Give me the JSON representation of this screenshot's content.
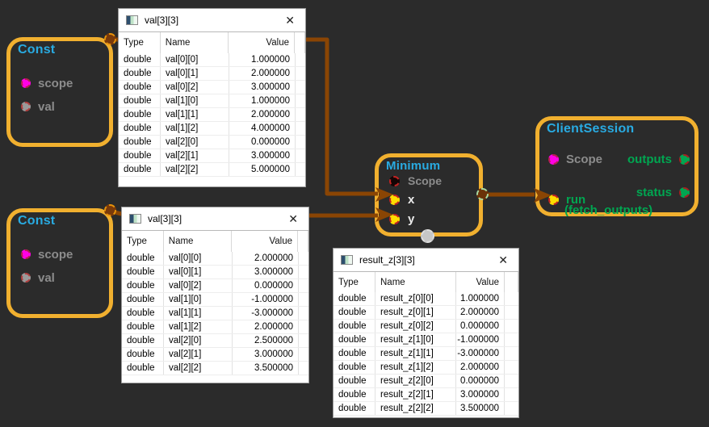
{
  "colors": {
    "background": "#2b2b2b",
    "node_border": "#f1b02f",
    "node_title": "#29abe2",
    "port_label_gray": "#8c8c8c",
    "port_label_white": "#eaeaea",
    "green": "#00a651",
    "magenta": "#ff00e6",
    "port_yellow": "#ffdd00",
    "wire": "#8a4504"
  },
  "nodes": {
    "const1": {
      "title": "Const",
      "ports": [
        {
          "label": "scope"
        },
        {
          "label": "val"
        }
      ]
    },
    "const2": {
      "title": "Const",
      "ports": [
        {
          "label": "scope"
        },
        {
          "label": "val"
        }
      ]
    },
    "minimum": {
      "title": "Minimum",
      "ports": [
        {
          "label": "Scope"
        },
        {
          "label": "x"
        },
        {
          "label": "y"
        }
      ]
    },
    "client_session": {
      "title": "ClientSession",
      "scope_label": "Scope",
      "outputs_label": "outputs",
      "status_label": "status",
      "run_label": "run",
      "run_sublabel": "(fetch_outputs)"
    }
  },
  "window_chrome": {
    "close_glyph": "✕"
  },
  "tables": [
    {
      "title": "val[3][3]",
      "columns": [
        "Type",
        "Name",
        "Value"
      ],
      "rows": [
        [
          "double",
          "val[0][0]",
          "1.000000"
        ],
        [
          "double",
          "val[0][1]",
          "2.000000"
        ],
        [
          "double",
          "val[0][2]",
          "3.000000"
        ],
        [
          "double",
          "val[1][0]",
          "1.000000"
        ],
        [
          "double",
          "val[1][1]",
          "2.000000"
        ],
        [
          "double",
          "val[1][2]",
          "4.000000"
        ],
        [
          "double",
          "val[2][0]",
          "0.000000"
        ],
        [
          "double",
          "val[2][1]",
          "3.000000"
        ],
        [
          "double",
          "val[2][2]",
          "5.000000"
        ]
      ]
    },
    {
      "title": "val[3][3]",
      "columns": [
        "Type",
        "Name",
        "Value"
      ],
      "rows": [
        [
          "double",
          "val[0][0]",
          "2.000000"
        ],
        [
          "double",
          "val[0][1]",
          "3.000000"
        ],
        [
          "double",
          "val[0][2]",
          "0.000000"
        ],
        [
          "double",
          "val[1][0]",
          "-1.000000"
        ],
        [
          "double",
          "val[1][1]",
          "-3.000000"
        ],
        [
          "double",
          "val[1][2]",
          "2.000000"
        ],
        [
          "double",
          "val[2][0]",
          "2.500000"
        ],
        [
          "double",
          "val[2][1]",
          "3.000000"
        ],
        [
          "double",
          "val[2][2]",
          "3.500000"
        ]
      ]
    },
    {
      "title": "result_z[3][3]",
      "columns": [
        "Type",
        "Name",
        "Value"
      ],
      "rows": [
        [
          "double",
          "result_z[0][0]",
          "1.000000"
        ],
        [
          "double",
          "result_z[0][1]",
          "2.000000"
        ],
        [
          "double",
          "result_z[0][2]",
          "0.000000"
        ],
        [
          "double",
          "result_z[1][0]",
          "-1.000000"
        ],
        [
          "double",
          "result_z[1][1]",
          "-3.000000"
        ],
        [
          "double",
          "result_z[1][2]",
          "2.000000"
        ],
        [
          "double",
          "result_z[2][0]",
          "0.000000"
        ],
        [
          "double",
          "result_z[2][1]",
          "3.000000"
        ],
        [
          "double",
          "result_z[2][2]",
          "3.500000"
        ]
      ]
    }
  ]
}
